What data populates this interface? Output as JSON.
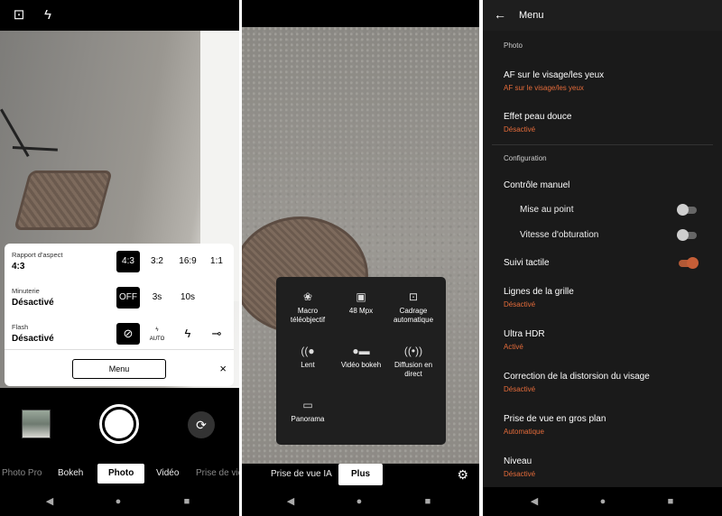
{
  "screen1": {
    "panel": {
      "aspect_label": "Rapport d'aspect",
      "aspect_value": "4:3",
      "aspect_options": [
        "4:3",
        "3:2",
        "16:9",
        "1:1"
      ],
      "timer_label": "Minuterie",
      "timer_value": "Désactivé",
      "timer_options": [
        "OFF",
        "3s",
        "10s"
      ],
      "flash_label": "Flash",
      "flash_value": "Désactivé",
      "flash_auto_label": "AUTO",
      "menu_button": "Menu",
      "close_icon": "×"
    },
    "modes": [
      "Photo Pro",
      "Bokeh",
      "Photo",
      "Vidéo",
      "Prise de vidéo"
    ],
    "selected_mode": "Photo"
  },
  "screen2": {
    "cells": [
      {
        "icon": "macro-icon",
        "label": "Macro téléobjectif"
      },
      {
        "icon": "48mp-icon",
        "label": "48 Mpx"
      },
      {
        "icon": "auto-framing-icon",
        "label": "Cadrage automatique"
      },
      {
        "icon": "slow-icon",
        "label": "Lent"
      },
      {
        "icon": "bokeh-video-icon",
        "label": "Vidéo bokeh"
      },
      {
        "icon": "live-icon",
        "label": "Diffusion en direct"
      },
      {
        "icon": "panorama-icon",
        "label": "Panorama"
      }
    ],
    "modes": [
      "Prise de vue IA",
      "Plus"
    ],
    "selected_mode": "Plus"
  },
  "screen3": {
    "title": "Menu",
    "section_photo": "Photo",
    "af_title": "AF sur le visage/les yeux",
    "af_value": "AF sur le visage/les yeux",
    "skin_title": "Effet peau douce",
    "skin_value": "Désactivé",
    "section_config": "Configuration",
    "manual_title": "Contrôle manuel",
    "focus_label": "Mise au point",
    "shutter_label": "Vitesse d'obturation",
    "tracking_label": "Suivi tactile",
    "grid_title": "Lignes de la grille",
    "grid_value": "Désactivé",
    "hdr_title": "Ultra HDR",
    "hdr_value": "Activé",
    "distortion_title": "Correction de la distorsion du visage",
    "distortion_value": "Désactivé",
    "closeup_title": "Prise de vue en gros plan",
    "closeup_value": "Automatique",
    "level_title": "Niveau",
    "level_value": "Désactivé",
    "toggles": {
      "focus": false,
      "shutter": false,
      "tracking": true
    }
  },
  "colors": {
    "accent": "#e46b3a",
    "menu_bg": "#1a1a1a",
    "panel_bg": "#ffffff"
  }
}
